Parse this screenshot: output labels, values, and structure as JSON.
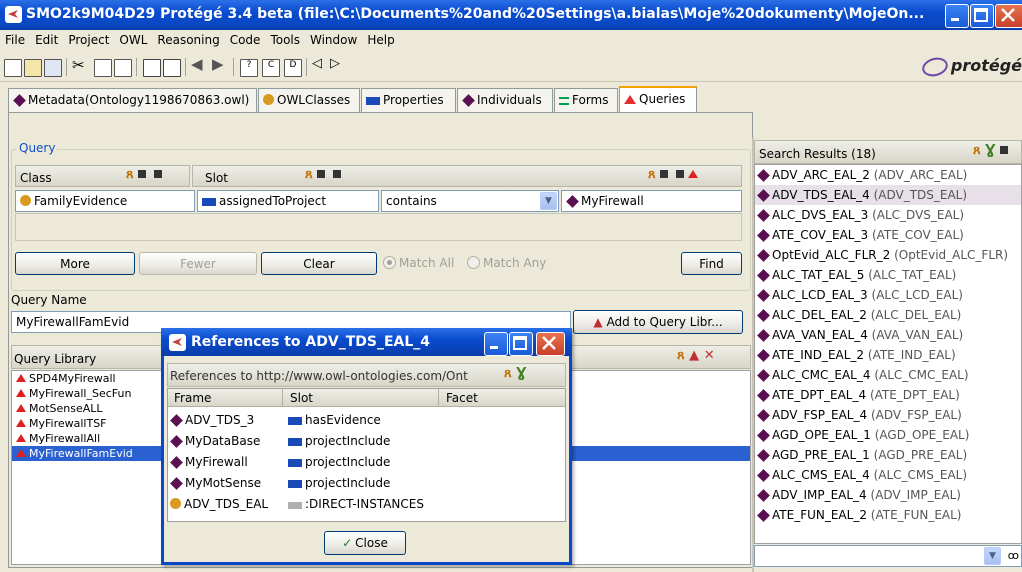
{
  "window": {
    "title": "SMO2k9M04D29  Protégé 3.4 beta    (file:\\C:\\Documents%20and%20Settings\\a.bialas\\Moje%20dokumenty\\MojeOn..."
  },
  "menu": [
    "File",
    "Edit",
    "Project",
    "OWL",
    "Reasoning",
    "Code",
    "Tools",
    "Window",
    "Help"
  ],
  "logo": "protégé",
  "tabs": [
    {
      "label": "Metadata(Ontology1198670863.owl)",
      "icon": "diamond-icon"
    },
    {
      "label": "OWLClasses",
      "icon": "circle-icon"
    },
    {
      "label": "Properties",
      "icon": "rectangle-icon"
    },
    {
      "label": "Individuals",
      "icon": "diamond-icon"
    },
    {
      "label": "Forms",
      "icon": "equals-icon"
    },
    {
      "label": "Queries",
      "icon": "triangle-icon",
      "selected": true
    }
  ],
  "query": {
    "group_label": "Query",
    "class_label": "Class",
    "slot_label": "Slot",
    "class_value": "FamilyEvidence",
    "slot_value": "assignedToProject",
    "operator": "contains",
    "value": "MyFirewall",
    "more": "More",
    "fewer": "Fewer",
    "clear": "Clear",
    "match_all": "Match All",
    "match_any": "Match Any",
    "find": "Find"
  },
  "query_name": {
    "label": "Query Name",
    "value": "MyFirewallFamEvid",
    "add_button": "Add to Query Libr..."
  },
  "query_library": {
    "label": "Query Library",
    "items": [
      "SPD4MyFirewall",
      "MyFirewall_SecFun",
      "MotSenseALL",
      "MyFirewallTSF",
      "MyFirewallAll",
      "MyFirewallFamEvid"
    ],
    "selected_index": 5
  },
  "search_results": {
    "label": "Search Results (18)",
    "items": [
      {
        "name": "ADV_ARC_EAL_2",
        "sub": "(ADV_ARC_EAL)"
      },
      {
        "name": "ADV_TDS_EAL_4",
        "sub": "(ADV_TDS_EAL)"
      },
      {
        "name": "ALC_DVS_EAL_3",
        "sub": "(ALC_DVS_EAL)"
      },
      {
        "name": "ATE_COV_EAL_3",
        "sub": "(ATE_COV_EAL)"
      },
      {
        "name": "OptEvid_ALC_FLR_2",
        "sub": "(OptEvid_ALC_FLR)"
      },
      {
        "name": "ALC_TAT_EAL_5",
        "sub": "(ALC_TAT_EAL)"
      },
      {
        "name": "ALC_LCD_EAL_3",
        "sub": "(ALC_LCD_EAL)"
      },
      {
        "name": "ALC_DEL_EAL_2",
        "sub": "(ALC_DEL_EAL)"
      },
      {
        "name": "AVA_VAN_EAL_4",
        "sub": "(AVA_VAN_EAL)"
      },
      {
        "name": "ATE_IND_EAL_2",
        "sub": "(ATE_IND_EAL)"
      },
      {
        "name": "ALC_CMC_EAL_4",
        "sub": "(ALC_CMC_EAL)"
      },
      {
        "name": "ATE_DPT_EAL_4",
        "sub": "(ATE_DPT_EAL)"
      },
      {
        "name": "ADV_FSP_EAL_4",
        "sub": "(ADV_FSP_EAL)"
      },
      {
        "name": "AGD_OPE_EAL_1",
        "sub": "(AGD_OPE_EAL)"
      },
      {
        "name": "AGD_PRE_EAL_1",
        "sub": "(AGD_PRE_EAL)"
      },
      {
        "name": "ALC_CMS_EAL_4",
        "sub": "(ALC_CMS_EAL)"
      },
      {
        "name": "ADV_IMP_EAL_4",
        "sub": "(ADV_IMP_EAL)"
      },
      {
        "name": "ATE_FUN_EAL_2",
        "sub": "(ATE_FUN_EAL)"
      }
    ],
    "highlighted_index": 1
  },
  "dialog": {
    "title": "References to ADV_TDS_EAL_4",
    "subtitle": "References to http://www.owl-ontologies.com/Ont",
    "columns": [
      "Frame",
      "Slot",
      "Facet"
    ],
    "rows": [
      {
        "frame": "ADV_TDS_3",
        "slot": "hasEvidence",
        "frame_icon": "diamond-icon"
      },
      {
        "frame": "MyDataBase",
        "slot": "projectInclude",
        "frame_icon": "diamond-icon"
      },
      {
        "frame": "MyFirewall",
        "slot": "projectInclude",
        "frame_icon": "diamond-icon"
      },
      {
        "frame": "MyMotSense",
        "slot": "projectInclude",
        "frame_icon": "diamond-icon"
      },
      {
        "frame": "ADV_TDS_EAL",
        "slot": ":DIRECT-INSTANCES",
        "frame_icon": "circle-icon"
      }
    ],
    "close": "Close"
  }
}
